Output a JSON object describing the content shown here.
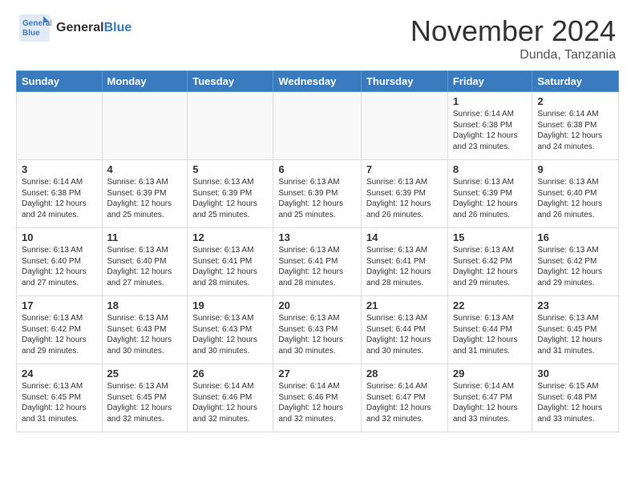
{
  "header": {
    "logo_general": "General",
    "logo_blue": "Blue",
    "month_title": "November 2024",
    "location": "Dunda, Tanzania"
  },
  "days_of_week": [
    "Sunday",
    "Monday",
    "Tuesday",
    "Wednesday",
    "Thursday",
    "Friday",
    "Saturday"
  ],
  "weeks": [
    [
      {
        "day": "",
        "info": ""
      },
      {
        "day": "",
        "info": ""
      },
      {
        "day": "",
        "info": ""
      },
      {
        "day": "",
        "info": ""
      },
      {
        "day": "",
        "info": ""
      },
      {
        "day": "1",
        "info": "Sunrise: 6:14 AM\nSunset: 6:38 PM\nDaylight: 12 hours and 23 minutes."
      },
      {
        "day": "2",
        "info": "Sunrise: 6:14 AM\nSunset: 6:38 PM\nDaylight: 12 hours and 24 minutes."
      }
    ],
    [
      {
        "day": "3",
        "info": "Sunrise: 6:14 AM\nSunset: 6:38 PM\nDaylight: 12 hours and 24 minutes."
      },
      {
        "day": "4",
        "info": "Sunrise: 6:13 AM\nSunset: 6:39 PM\nDaylight: 12 hours and 25 minutes."
      },
      {
        "day": "5",
        "info": "Sunrise: 6:13 AM\nSunset: 6:39 PM\nDaylight: 12 hours and 25 minutes."
      },
      {
        "day": "6",
        "info": "Sunrise: 6:13 AM\nSunset: 6:39 PM\nDaylight: 12 hours and 25 minutes."
      },
      {
        "day": "7",
        "info": "Sunrise: 6:13 AM\nSunset: 6:39 PM\nDaylight: 12 hours and 26 minutes."
      },
      {
        "day": "8",
        "info": "Sunrise: 6:13 AM\nSunset: 6:39 PM\nDaylight: 12 hours and 26 minutes."
      },
      {
        "day": "9",
        "info": "Sunrise: 6:13 AM\nSunset: 6:40 PM\nDaylight: 12 hours and 26 minutes."
      }
    ],
    [
      {
        "day": "10",
        "info": "Sunrise: 6:13 AM\nSunset: 6:40 PM\nDaylight: 12 hours and 27 minutes."
      },
      {
        "day": "11",
        "info": "Sunrise: 6:13 AM\nSunset: 6:40 PM\nDaylight: 12 hours and 27 minutes."
      },
      {
        "day": "12",
        "info": "Sunrise: 6:13 AM\nSunset: 6:41 PM\nDaylight: 12 hours and 28 minutes."
      },
      {
        "day": "13",
        "info": "Sunrise: 6:13 AM\nSunset: 6:41 PM\nDaylight: 12 hours and 28 minutes."
      },
      {
        "day": "14",
        "info": "Sunrise: 6:13 AM\nSunset: 6:41 PM\nDaylight: 12 hours and 28 minutes."
      },
      {
        "day": "15",
        "info": "Sunrise: 6:13 AM\nSunset: 6:42 PM\nDaylight: 12 hours and 29 minutes."
      },
      {
        "day": "16",
        "info": "Sunrise: 6:13 AM\nSunset: 6:42 PM\nDaylight: 12 hours and 29 minutes."
      }
    ],
    [
      {
        "day": "17",
        "info": "Sunrise: 6:13 AM\nSunset: 6:42 PM\nDaylight: 12 hours and 29 minutes."
      },
      {
        "day": "18",
        "info": "Sunrise: 6:13 AM\nSunset: 6:43 PM\nDaylight: 12 hours and 30 minutes."
      },
      {
        "day": "19",
        "info": "Sunrise: 6:13 AM\nSunset: 6:43 PM\nDaylight: 12 hours and 30 minutes."
      },
      {
        "day": "20",
        "info": "Sunrise: 6:13 AM\nSunset: 6:43 PM\nDaylight: 12 hours and 30 minutes."
      },
      {
        "day": "21",
        "info": "Sunrise: 6:13 AM\nSunset: 6:44 PM\nDaylight: 12 hours and 30 minutes."
      },
      {
        "day": "22",
        "info": "Sunrise: 6:13 AM\nSunset: 6:44 PM\nDaylight: 12 hours and 31 minutes."
      },
      {
        "day": "23",
        "info": "Sunrise: 6:13 AM\nSunset: 6:45 PM\nDaylight: 12 hours and 31 minutes."
      }
    ],
    [
      {
        "day": "24",
        "info": "Sunrise: 6:13 AM\nSunset: 6:45 PM\nDaylight: 12 hours and 31 minutes."
      },
      {
        "day": "25",
        "info": "Sunrise: 6:13 AM\nSunset: 6:45 PM\nDaylight: 12 hours and 32 minutes."
      },
      {
        "day": "26",
        "info": "Sunrise: 6:14 AM\nSunset: 6:46 PM\nDaylight: 12 hours and 32 minutes."
      },
      {
        "day": "27",
        "info": "Sunrise: 6:14 AM\nSunset: 6:46 PM\nDaylight: 12 hours and 32 minutes."
      },
      {
        "day": "28",
        "info": "Sunrise: 6:14 AM\nSunset: 6:47 PM\nDaylight: 12 hours and 32 minutes."
      },
      {
        "day": "29",
        "info": "Sunrise: 6:14 AM\nSunset: 6:47 PM\nDaylight: 12 hours and 33 minutes."
      },
      {
        "day": "30",
        "info": "Sunrise: 6:15 AM\nSunset: 6:48 PM\nDaylight: 12 hours and 33 minutes."
      }
    ]
  ]
}
